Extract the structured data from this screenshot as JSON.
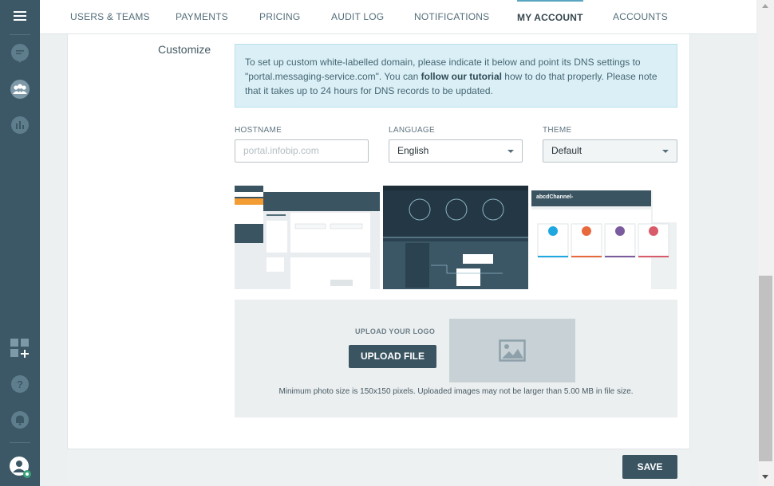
{
  "nav": {
    "tabs": [
      {
        "label": "USERS & TEAMS"
      },
      {
        "label": "PAYMENTS"
      },
      {
        "label": "PRICING"
      },
      {
        "label": "AUDIT LOG"
      },
      {
        "label": "NOTIFICATIONS"
      },
      {
        "label": "MY ACCOUNT",
        "active": true
      },
      {
        "label": "ACCOUNTS"
      }
    ]
  },
  "sidebar": {
    "icons": [
      "menu-icon",
      "conversations-icon",
      "users-icon",
      "analytics-icon",
      "apps-add-icon",
      "help-icon",
      "notifications-icon",
      "profile-icon"
    ]
  },
  "customize": {
    "section_label": "Customize",
    "info_prefix": "To set up custom white-labelled domain, please indicate it below and point its DNS settings to \"portal.messaging-service.com\". You can ",
    "info_link": "follow our tutorial",
    "info_suffix": " how to do that properly. Please note that it takes up to 24 hours for DNS records to be updated.",
    "hostname_label": "HOSTNAME",
    "hostname_placeholder": "portal.infobip.com",
    "language_label": "LANGUAGE",
    "language_value": "English",
    "theme_label": "THEME",
    "theme_value": "Default"
  },
  "thumbnails": {
    "third_title": "abcdChannel-"
  },
  "upload": {
    "label": "UPLOAD YOUR LOGO",
    "button": "UPLOAD FILE",
    "hint": "Minimum photo size is 150x150 pixels. Uploaded images may not be larger than 5.00 MB in file size."
  },
  "footer": {
    "save": "SAVE"
  },
  "colors": {
    "sidebar": "#3c5866",
    "accent": "#5aa6c1",
    "button": "#3a5462",
    "info_bg": "#dbf0f6"
  }
}
